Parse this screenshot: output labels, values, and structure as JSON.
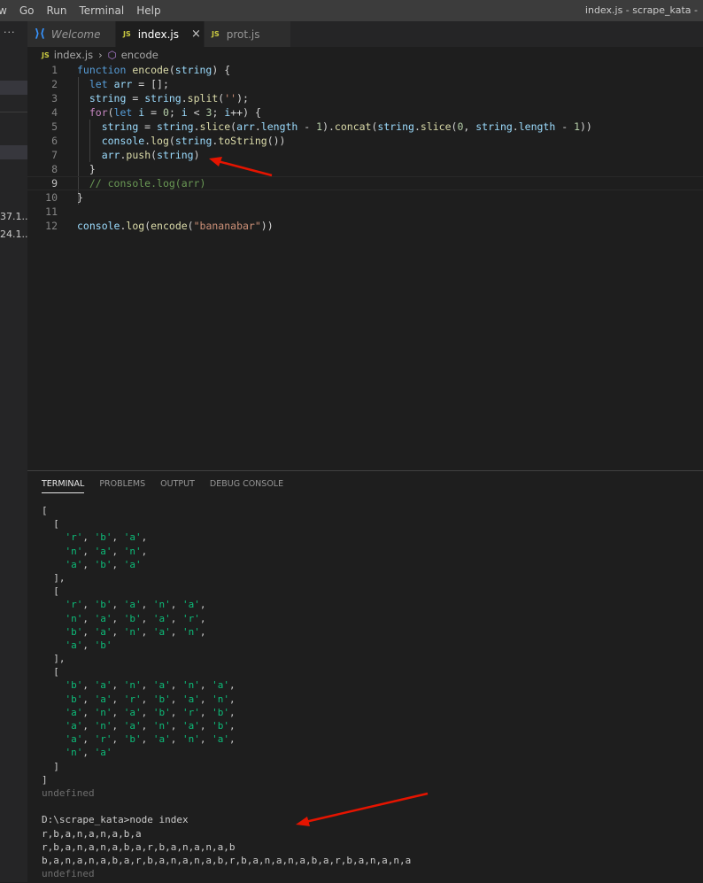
{
  "menubar": {
    "items": [
      "w",
      "Go",
      "Run",
      "Terminal",
      "Help"
    ],
    "window_title": "index.js - scrape_kata -"
  },
  "sidebar": {
    "dots": "···",
    "texts": [
      "37.1...",
      "24.1..."
    ]
  },
  "tabs": [
    {
      "icon": "vscode-icon",
      "label": "Welcome"
    },
    {
      "icon": "js-icon",
      "label": "index.js",
      "active": true,
      "close": "×"
    },
    {
      "icon": "js-icon",
      "label": "prot.js"
    }
  ],
  "js_badge": "JS",
  "breadcrumb": {
    "file": "index.js",
    "symbol": "encode"
  },
  "code_lines": [
    {
      "n": "1",
      "tokens": [
        [
          "kw",
          "function "
        ],
        [
          "fn",
          "encode"
        ],
        [
          "pl",
          "("
        ],
        [
          "var",
          "string"
        ],
        [
          "pl",
          ") {"
        ]
      ]
    },
    {
      "n": "2",
      "tokens": [
        [
          "pl",
          "  "
        ],
        [
          "kw",
          "let "
        ],
        [
          "var",
          "arr"
        ],
        [
          "pl",
          " = [];"
        ]
      ]
    },
    {
      "n": "3",
      "tokens": [
        [
          "pl",
          "  "
        ],
        [
          "var",
          "string"
        ],
        [
          "pl",
          " = "
        ],
        [
          "var",
          "string"
        ],
        [
          "pl",
          "."
        ],
        [
          "fn",
          "split"
        ],
        [
          "pl",
          "("
        ],
        [
          "str",
          "''"
        ],
        [
          "pl",
          ");"
        ]
      ]
    },
    {
      "n": "4",
      "tokens": [
        [
          "pl",
          "  "
        ],
        [
          "kw2",
          "for"
        ],
        [
          "pl",
          "("
        ],
        [
          "kw",
          "let "
        ],
        [
          "var",
          "i"
        ],
        [
          "pl",
          " = "
        ],
        [
          "num",
          "0"
        ],
        [
          "pl",
          "; "
        ],
        [
          "var",
          "i"
        ],
        [
          "pl",
          " < "
        ],
        [
          "num",
          "3"
        ],
        [
          "pl",
          "; "
        ],
        [
          "var",
          "i"
        ],
        [
          "pl",
          "++) {"
        ]
      ]
    },
    {
      "n": "5",
      "tokens": [
        [
          "pl",
          "    "
        ],
        [
          "var",
          "string"
        ],
        [
          "pl",
          " = "
        ],
        [
          "var",
          "string"
        ],
        [
          "pl",
          "."
        ],
        [
          "fn",
          "slice"
        ],
        [
          "pl",
          "("
        ],
        [
          "var",
          "arr"
        ],
        [
          "pl",
          "."
        ],
        [
          "var",
          "length"
        ],
        [
          "pl",
          " - "
        ],
        [
          "num",
          "1"
        ],
        [
          "pl",
          ")."
        ],
        [
          "fn",
          "concat"
        ],
        [
          "pl",
          "("
        ],
        [
          "var",
          "string"
        ],
        [
          "pl",
          "."
        ],
        [
          "fn",
          "slice"
        ],
        [
          "pl",
          "("
        ],
        [
          "num",
          "0"
        ],
        [
          "pl",
          ", "
        ],
        [
          "var",
          "string"
        ],
        [
          "pl",
          "."
        ],
        [
          "var",
          "length"
        ],
        [
          "pl",
          " - "
        ],
        [
          "num",
          "1"
        ],
        [
          "pl",
          "))"
        ]
      ]
    },
    {
      "n": "6",
      "tokens": [
        [
          "pl",
          "    "
        ],
        [
          "var",
          "console"
        ],
        [
          "pl",
          "."
        ],
        [
          "fn",
          "log"
        ],
        [
          "pl",
          "("
        ],
        [
          "var",
          "string"
        ],
        [
          "pl",
          "."
        ],
        [
          "fn",
          "toString"
        ],
        [
          "pl",
          "())"
        ]
      ]
    },
    {
      "n": "7",
      "tokens": [
        [
          "pl",
          "    "
        ],
        [
          "var",
          "arr"
        ],
        [
          "pl",
          "."
        ],
        [
          "fn",
          "push"
        ],
        [
          "pl",
          "("
        ],
        [
          "var",
          "string"
        ],
        [
          "pl",
          ")"
        ]
      ]
    },
    {
      "n": "8",
      "tokens": [
        [
          "pl",
          "  }"
        ]
      ]
    },
    {
      "n": "9",
      "tokens": [
        [
          "pl",
          "  "
        ],
        [
          "cm",
          "// console.log(arr)"
        ]
      ]
    },
    {
      "n": "10",
      "tokens": [
        [
          "pl",
          "}"
        ]
      ]
    },
    {
      "n": "11",
      "tokens": []
    },
    {
      "n": "12",
      "tokens": [
        [
          "var",
          "console"
        ],
        [
          "pl",
          "."
        ],
        [
          "fn",
          "log"
        ],
        [
          "pl",
          "("
        ],
        [
          "fn",
          "encode"
        ],
        [
          "pl",
          "("
        ],
        [
          "str",
          "\"bananabar\""
        ],
        [
          "pl",
          "))"
        ]
      ]
    }
  ],
  "panel_tabs": [
    "TERMINAL",
    "PROBLEMS",
    "OUTPUT",
    "DEBUG CONSOLE"
  ],
  "terminal_lines": [
    [
      [
        "p",
        "["
      ]
    ],
    [
      [
        "p",
        "  ["
      ]
    ],
    [
      [
        "p",
        "    "
      ],
      [
        "s",
        "'r'"
      ],
      [
        "p",
        ", "
      ],
      [
        "s",
        "'b'"
      ],
      [
        "p",
        ", "
      ],
      [
        "s",
        "'a'"
      ],
      [
        "p",
        ","
      ]
    ],
    [
      [
        "p",
        "    "
      ],
      [
        "s",
        "'n'"
      ],
      [
        "p",
        ", "
      ],
      [
        "s",
        "'a'"
      ],
      [
        "p",
        ", "
      ],
      [
        "s",
        "'n'"
      ],
      [
        "p",
        ","
      ]
    ],
    [
      [
        "p",
        "    "
      ],
      [
        "s",
        "'a'"
      ],
      [
        "p",
        ", "
      ],
      [
        "s",
        "'b'"
      ],
      [
        "p",
        ", "
      ],
      [
        "s",
        "'a'"
      ]
    ],
    [
      [
        "p",
        "  ],"
      ]
    ],
    [
      [
        "p",
        "  ["
      ]
    ],
    [
      [
        "p",
        "    "
      ],
      [
        "s",
        "'r'"
      ],
      [
        "p",
        ", "
      ],
      [
        "s",
        "'b'"
      ],
      [
        "p",
        ", "
      ],
      [
        "s",
        "'a'"
      ],
      [
        "p",
        ", "
      ],
      [
        "s",
        "'n'"
      ],
      [
        "p",
        ", "
      ],
      [
        "s",
        "'a'"
      ],
      [
        "p",
        ","
      ]
    ],
    [
      [
        "p",
        "    "
      ],
      [
        "s",
        "'n'"
      ],
      [
        "p",
        ", "
      ],
      [
        "s",
        "'a'"
      ],
      [
        "p",
        ", "
      ],
      [
        "s",
        "'b'"
      ],
      [
        "p",
        ", "
      ],
      [
        "s",
        "'a'"
      ],
      [
        "p",
        ", "
      ],
      [
        "s",
        "'r'"
      ],
      [
        "p",
        ","
      ]
    ],
    [
      [
        "p",
        "    "
      ],
      [
        "s",
        "'b'"
      ],
      [
        "p",
        ", "
      ],
      [
        "s",
        "'a'"
      ],
      [
        "p",
        ", "
      ],
      [
        "s",
        "'n'"
      ],
      [
        "p",
        ", "
      ],
      [
        "s",
        "'a'"
      ],
      [
        "p",
        ", "
      ],
      [
        "s",
        "'n'"
      ],
      [
        "p",
        ","
      ]
    ],
    [
      [
        "p",
        "    "
      ],
      [
        "s",
        "'a'"
      ],
      [
        "p",
        ", "
      ],
      [
        "s",
        "'b'"
      ]
    ],
    [
      [
        "p",
        "  ],"
      ]
    ],
    [
      [
        "p",
        "  ["
      ]
    ],
    [
      [
        "p",
        "    "
      ],
      [
        "s",
        "'b'"
      ],
      [
        "p",
        ", "
      ],
      [
        "s",
        "'a'"
      ],
      [
        "p",
        ", "
      ],
      [
        "s",
        "'n'"
      ],
      [
        "p",
        ", "
      ],
      [
        "s",
        "'a'"
      ],
      [
        "p",
        ", "
      ],
      [
        "s",
        "'n'"
      ],
      [
        "p",
        ", "
      ],
      [
        "s",
        "'a'"
      ],
      [
        "p",
        ","
      ]
    ],
    [
      [
        "p",
        "    "
      ],
      [
        "s",
        "'b'"
      ],
      [
        "p",
        ", "
      ],
      [
        "s",
        "'a'"
      ],
      [
        "p",
        ", "
      ],
      [
        "s",
        "'r'"
      ],
      [
        "p",
        ", "
      ],
      [
        "s",
        "'b'"
      ],
      [
        "p",
        ", "
      ],
      [
        "s",
        "'a'"
      ],
      [
        "p",
        ", "
      ],
      [
        "s",
        "'n'"
      ],
      [
        "p",
        ","
      ]
    ],
    [
      [
        "p",
        "    "
      ],
      [
        "s",
        "'a'"
      ],
      [
        "p",
        ", "
      ],
      [
        "s",
        "'n'"
      ],
      [
        "p",
        ", "
      ],
      [
        "s",
        "'a'"
      ],
      [
        "p",
        ", "
      ],
      [
        "s",
        "'b'"
      ],
      [
        "p",
        ", "
      ],
      [
        "s",
        "'r'"
      ],
      [
        "p",
        ", "
      ],
      [
        "s",
        "'b'"
      ],
      [
        "p",
        ","
      ]
    ],
    [
      [
        "p",
        "    "
      ],
      [
        "s",
        "'a'"
      ],
      [
        "p",
        ", "
      ],
      [
        "s",
        "'n'"
      ],
      [
        "p",
        ", "
      ],
      [
        "s",
        "'a'"
      ],
      [
        "p",
        ", "
      ],
      [
        "s",
        "'n'"
      ],
      [
        "p",
        ", "
      ],
      [
        "s",
        "'a'"
      ],
      [
        "p",
        ", "
      ],
      [
        "s",
        "'b'"
      ],
      [
        "p",
        ","
      ]
    ],
    [
      [
        "p",
        "    "
      ],
      [
        "s",
        "'a'"
      ],
      [
        "p",
        ", "
      ],
      [
        "s",
        "'r'"
      ],
      [
        "p",
        ", "
      ],
      [
        "s",
        "'b'"
      ],
      [
        "p",
        ", "
      ],
      [
        "s",
        "'a'"
      ],
      [
        "p",
        ", "
      ],
      [
        "s",
        "'n'"
      ],
      [
        "p",
        ", "
      ],
      [
        "s",
        "'a'"
      ],
      [
        "p",
        ","
      ]
    ],
    [
      [
        "p",
        "    "
      ],
      [
        "s",
        "'n'"
      ],
      [
        "p",
        ", "
      ],
      [
        "s",
        "'a'"
      ]
    ],
    [
      [
        "p",
        "  ]"
      ]
    ],
    [
      [
        "p",
        "]"
      ]
    ],
    [
      [
        "d",
        "undefined"
      ]
    ],
    [
      [
        "p",
        ""
      ]
    ],
    [
      [
        "p",
        "D:\\scrape_kata>node index"
      ]
    ],
    [
      [
        "p",
        "r,b,a,n,a,n,a,b,a"
      ]
    ],
    [
      [
        "p",
        "r,b,a,n,a,n,a,b,a,r,b,a,n,a,n,a,b"
      ]
    ],
    [
      [
        "p",
        "b,a,n,a,n,a,b,a,r,b,a,n,a,n,a,b,r,b,a,n,a,n,a,b,a,r,b,a,n,a,n,a"
      ]
    ],
    [
      [
        "d",
        "undefined"
      ]
    ]
  ],
  "colors": {
    "annotation_arrow": "#e51400",
    "terminal_string": "#0dbc79"
  }
}
